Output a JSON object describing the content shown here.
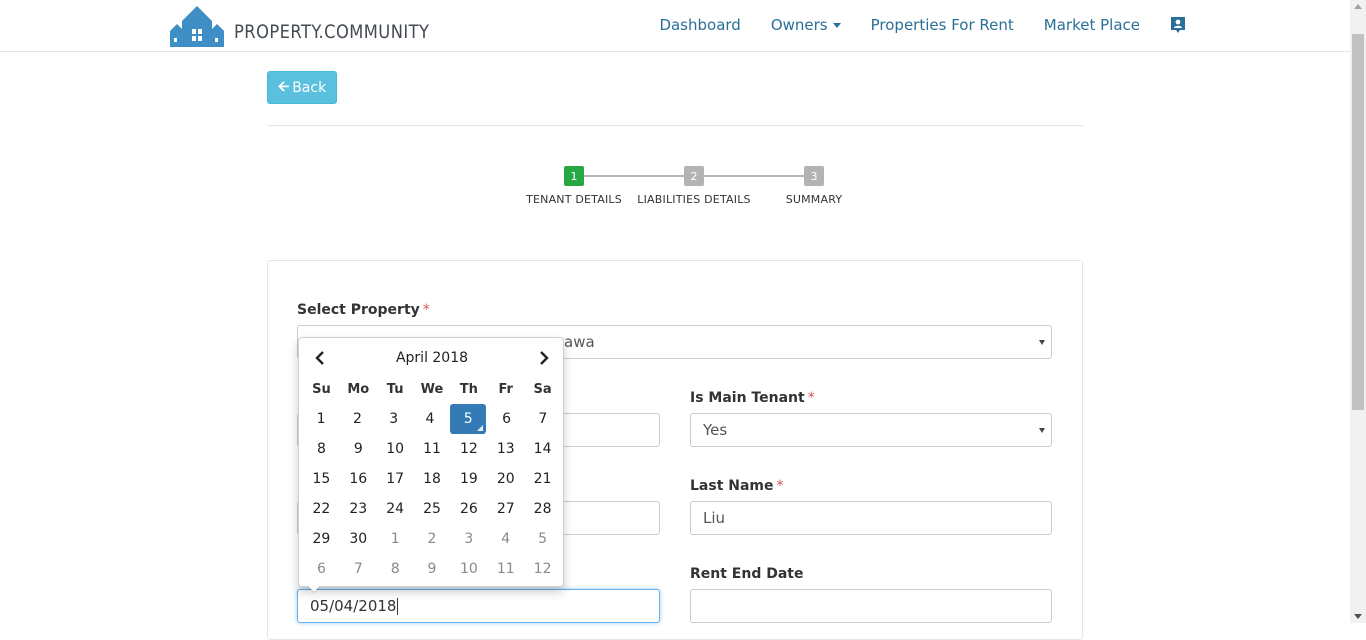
{
  "brand": {
    "name": "PROPERTY.COMMUNITY",
    "logo_icon": "house-logo-icon",
    "color": "#3f8fc6"
  },
  "nav": {
    "links": [
      "Dashboard",
      "Owners",
      "Properties For Rent",
      "Market Place"
    ],
    "user_icon": "user-card-icon",
    "link_color": "#2a6f97"
  },
  "back_button": {
    "label": "Back",
    "icon": "arrow-left-icon"
  },
  "stepper": {
    "steps": [
      {
        "number": "1",
        "label": "TENANT DETAILS",
        "state": "active",
        "color": "#28a745"
      },
      {
        "number": "2",
        "label": "LIABILITIES DETAILS",
        "state": "inactive",
        "color": "#b3b3b3"
      },
      {
        "number": "3",
        "label": "SUMMARY",
        "state": "inactive",
        "color": "#b3b3b3"
      }
    ]
  },
  "form": {
    "select_property": {
      "label": "Select Property",
      "required_mark": "*",
      "value": "awa"
    },
    "is_main_tenant": {
      "label": "Is Main Tenant",
      "required_mark": "*",
      "value": "Yes"
    },
    "last_name": {
      "label": "Last Name",
      "required_mark": "*",
      "value": "Liu"
    },
    "rent_end_date": {
      "label": "Rent End Date",
      "value": ""
    },
    "rent_start_date": {
      "value": "05/04/2018"
    }
  },
  "datepicker": {
    "title": "April 2018",
    "prev_icon": "chevron-left-icon",
    "next_icon": "chevron-right-icon",
    "weekdays": [
      "Su",
      "Mo",
      "Tu",
      "We",
      "Th",
      "Fr",
      "Sa"
    ],
    "weeks": [
      [
        "1",
        "2",
        "3",
        "4",
        "5",
        "6",
        "7"
      ],
      [
        "8",
        "9",
        "10",
        "11",
        "12",
        "13",
        "14"
      ],
      [
        "15",
        "16",
        "17",
        "18",
        "19",
        "20",
        "21"
      ],
      [
        "22",
        "23",
        "24",
        "25",
        "26",
        "27",
        "28"
      ],
      [
        "29",
        "30",
        "1",
        "2",
        "3",
        "4",
        "5"
      ],
      [
        "6",
        "7",
        "8",
        "9",
        "10",
        "11",
        "12"
      ]
    ],
    "selected_day": "5",
    "selected_color": "#337ab7"
  }
}
